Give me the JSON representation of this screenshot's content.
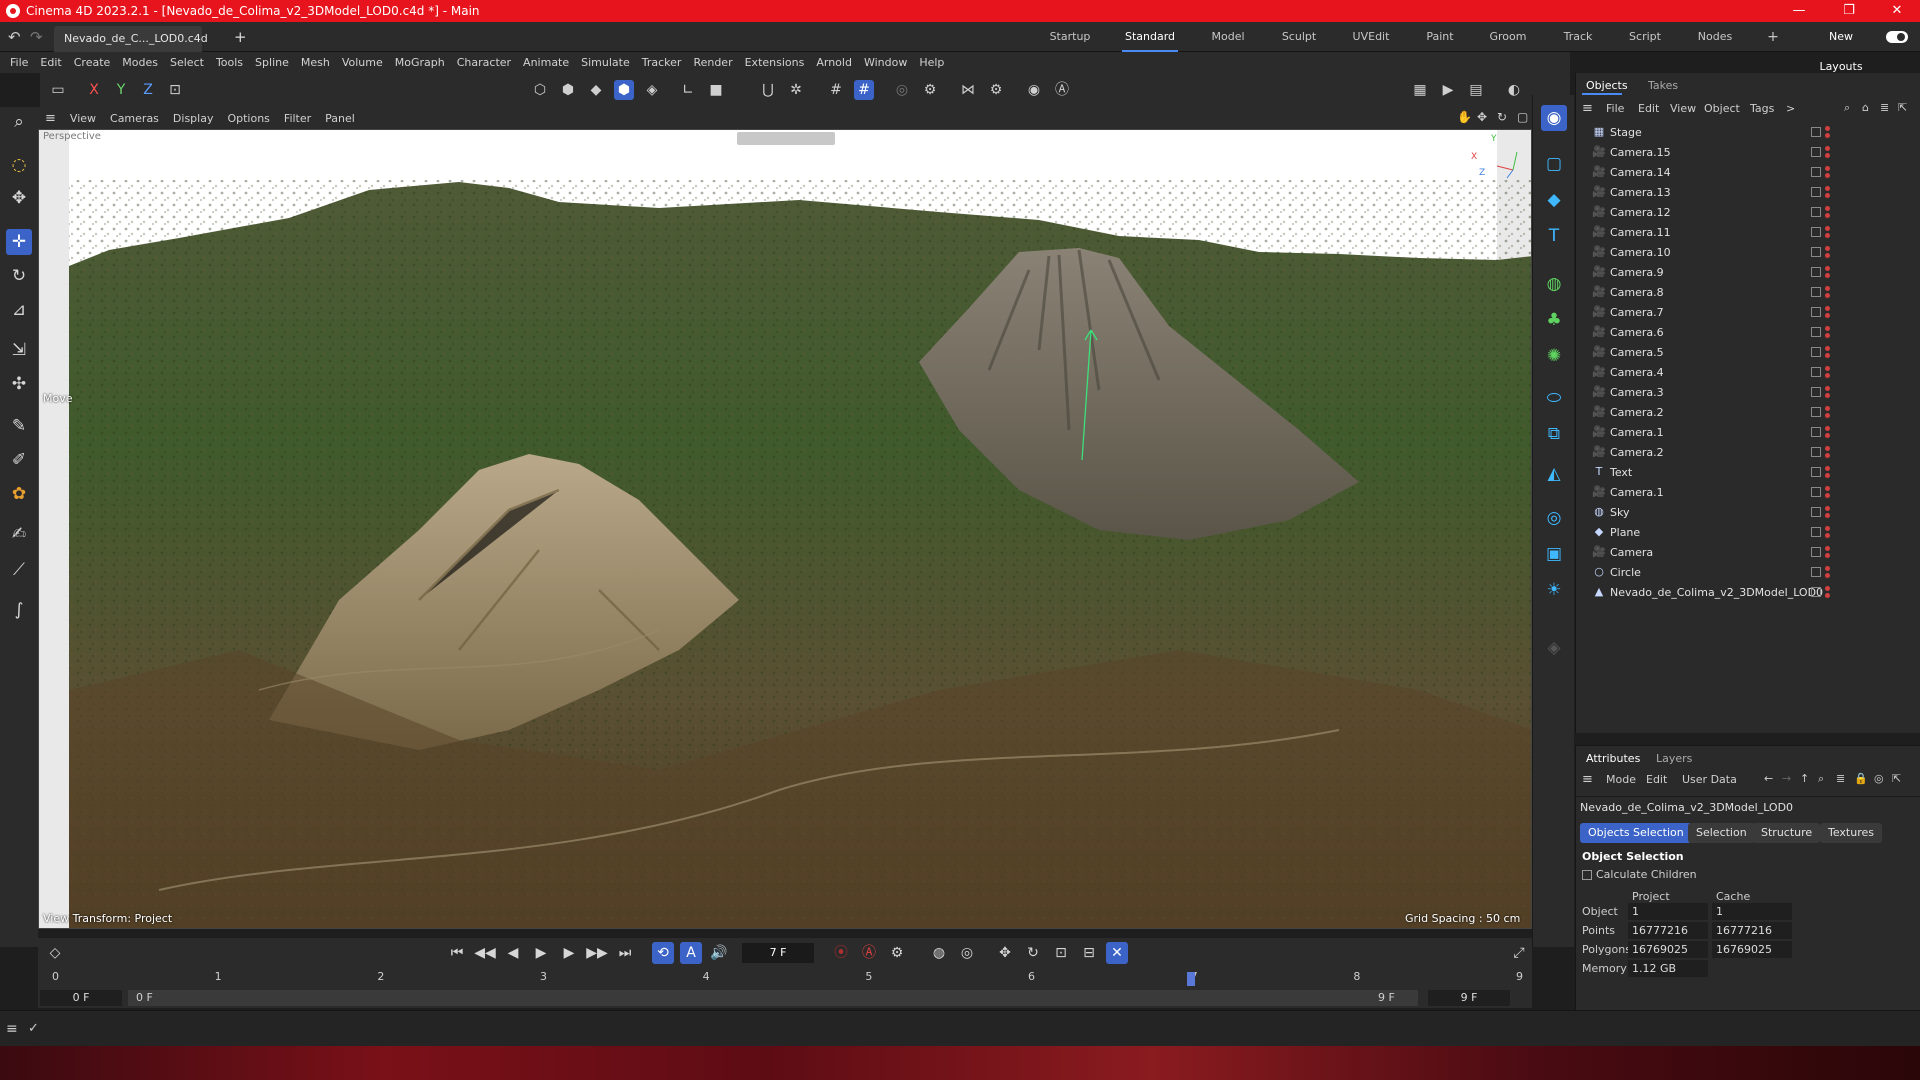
{
  "title_bar": {
    "title": "Cinema 4D 2023.2.1 - [Nevado_de_Colima_v2_3DModel_LOD0.c4d *] - Main",
    "minimize": "—",
    "maximize": "❐",
    "close": "✕"
  },
  "tabs": {
    "document": "Nevado_de_C..._LOD0.c4d *",
    "add": "+",
    "layouts": [
      "Startup",
      "Standard",
      "Model",
      "Sculpt",
      "UVEdit",
      "Paint",
      "Groom",
      "Track",
      "Script",
      "Nodes"
    ],
    "active_layout": "Standard",
    "add_layout": "+",
    "new_layouts": "New Layouts"
  },
  "menu": {
    "items": [
      "File",
      "Edit",
      "Create",
      "Modes",
      "Select",
      "Tools",
      "Spline",
      "Mesh",
      "Volume",
      "MoGraph",
      "Character",
      "Animate",
      "Simulate",
      "Tracker",
      "Render",
      "Extensions",
      "Arnold",
      "Window",
      "Help"
    ]
  },
  "toolbar": {
    "axis_x": "X",
    "axis_y": "Y",
    "axis_z": "Z"
  },
  "viewport": {
    "menu": [
      "View",
      "Cameras",
      "Display",
      "Options",
      "Filter",
      "Panel"
    ],
    "camera_label": "Perspective",
    "move_label": "Move",
    "view_transform": "View Transform: Project",
    "grid_spacing": "Grid Spacing : 50 cm",
    "axis_x": "X",
    "axis_y": "Y",
    "axis_z": "Z"
  },
  "objects_panel": {
    "tabs": [
      "Objects",
      "Takes"
    ],
    "menu": [
      "File",
      "Edit",
      "View",
      "Object",
      "Tags"
    ],
    "more": ">",
    "items": [
      {
        "name": "Stage",
        "icon": "stage-icon",
        "glyph": "▦"
      },
      {
        "name": "Camera.15",
        "icon": "camera-icon",
        "glyph": "🎥"
      },
      {
        "name": "Camera.14",
        "icon": "camera-icon",
        "glyph": "🎥"
      },
      {
        "name": "Camera.13",
        "icon": "camera-icon",
        "glyph": "🎥"
      },
      {
        "name": "Camera.12",
        "icon": "camera-icon",
        "glyph": "🎥"
      },
      {
        "name": "Camera.11",
        "icon": "camera-icon",
        "glyph": "🎥"
      },
      {
        "name": "Camera.10",
        "icon": "camera-icon",
        "glyph": "🎥"
      },
      {
        "name": "Camera.9",
        "icon": "camera-icon",
        "glyph": "🎥"
      },
      {
        "name": "Camera.8",
        "icon": "camera-icon",
        "glyph": "🎥"
      },
      {
        "name": "Camera.7",
        "icon": "camera-icon",
        "glyph": "🎥"
      },
      {
        "name": "Camera.6",
        "icon": "camera-icon",
        "glyph": "🎥"
      },
      {
        "name": "Camera.5",
        "icon": "camera-icon",
        "glyph": "🎥"
      },
      {
        "name": "Camera.4",
        "icon": "camera-icon",
        "glyph": "🎥"
      },
      {
        "name": "Camera.3",
        "icon": "camera-icon",
        "glyph": "🎥"
      },
      {
        "name": "Camera.2",
        "icon": "camera-icon",
        "glyph": "🎥"
      },
      {
        "name": "Camera.1",
        "icon": "camera-icon",
        "glyph": "🎥"
      },
      {
        "name": "Camera.2",
        "icon": "camera-icon",
        "glyph": "🎥"
      },
      {
        "name": "Text",
        "icon": "text-icon",
        "glyph": "T"
      },
      {
        "name": "Camera.1",
        "icon": "camera-icon",
        "glyph": "🎥"
      },
      {
        "name": "Sky",
        "icon": "sky-icon",
        "glyph": "◍"
      },
      {
        "name": "Plane",
        "icon": "plane-icon",
        "glyph": "◆"
      },
      {
        "name": "Camera",
        "icon": "camera-icon",
        "glyph": "🎥"
      },
      {
        "name": "Circle",
        "icon": "circle-icon",
        "glyph": "○"
      },
      {
        "name": "Nevado_de_Colima_v2_3DModel_LOD0",
        "icon": "mesh-icon",
        "glyph": "▲"
      }
    ]
  },
  "attributes_panel": {
    "tabs": [
      "Attributes",
      "Layers"
    ],
    "menu": [
      "Mode",
      "Edit",
      "User Data"
    ],
    "object_name": "Nevado_de_Colima_v2_3DModel_LOD0",
    "buttons": [
      "Objects Selection",
      "Selection",
      "Structure",
      "Textures"
    ],
    "active_button": "Objects Selection",
    "section_title": "Object Selection",
    "calculate_children": "Calculate Children",
    "col_project": "Project",
    "col_cache": "Cache",
    "rows": [
      {
        "label": "Object",
        "project": "1",
        "cache": "1"
      },
      {
        "label": "Points",
        "project": "16777216",
        "cache": "16777216"
      },
      {
        "label": "Polygons",
        "project": "16769025",
        "cache": "16769025"
      },
      {
        "label": "Memory",
        "project": "1.12 GB",
        "cache": ""
      }
    ]
  },
  "timeline": {
    "current_frame": "7 F",
    "ruler": [
      "0",
      "1",
      "2",
      "3",
      "4",
      "5",
      "6",
      "7",
      "8",
      "9"
    ],
    "start_frame": "0 F",
    "range_start": "0 F",
    "range_end": "9 F",
    "end_frame": "9 F",
    "playhead_frame": 7,
    "total_frames": 9
  },
  "colors": {
    "title_bar": "#e8141d",
    "accent": "#3c64c8",
    "panel": "#2b2b2b"
  }
}
